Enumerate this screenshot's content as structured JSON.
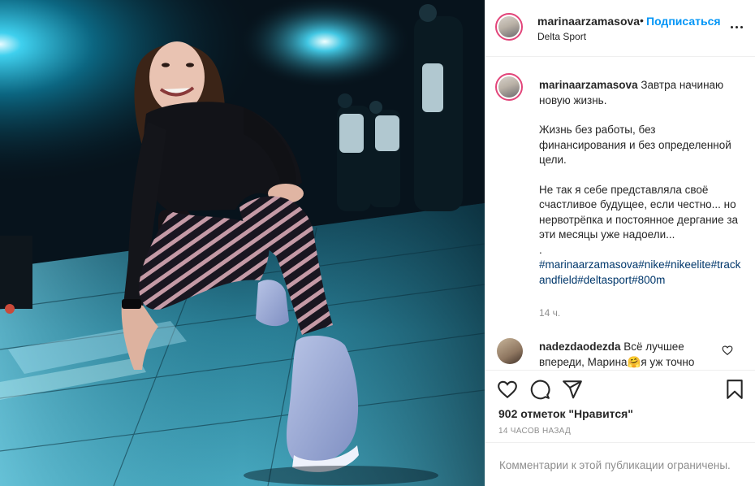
{
  "header": {
    "username": "marinaarzamasova",
    "dot": "•",
    "follow_label": "Подписаться",
    "location": "Delta Sport"
  },
  "caption": {
    "username": "marinaarzamasova",
    "line1": "Завтра начинаю новую жизнь.",
    "para2": "Жизнь без работы, без финансирования и без определенной цели.",
    "para3": "Не так я себе представляла своё счастливое будущее, если честно... но нервотрёпка и постоянное дергание за эти месяцы уже надоели...",
    "dot_line": ".",
    "hashtags": "#marinaarzamasova#nike#nikeelite#trackandfield#deltasport#800m",
    "time": "14 ч."
  },
  "comment": {
    "username": "nadezdaodezda",
    "text": "Всё лучшее впереди, Марина🤗я уж точно"
  },
  "actions": {
    "likes_text": "902 отметок \"Нравится\"",
    "time_ago": "14 ЧАСОВ НАЗАД",
    "icons": [
      "heart-icon",
      "comment-icon",
      "share-icon",
      "bookmark-icon"
    ]
  },
  "footer": {
    "comments_limited": "Комментарии к этой публикации ограничены."
  },
  "colors": {
    "accent": "#0095f6",
    "hashtag": "#00376b",
    "muted": "#8e8e8e",
    "photo_tone": "#0d4b63"
  }
}
